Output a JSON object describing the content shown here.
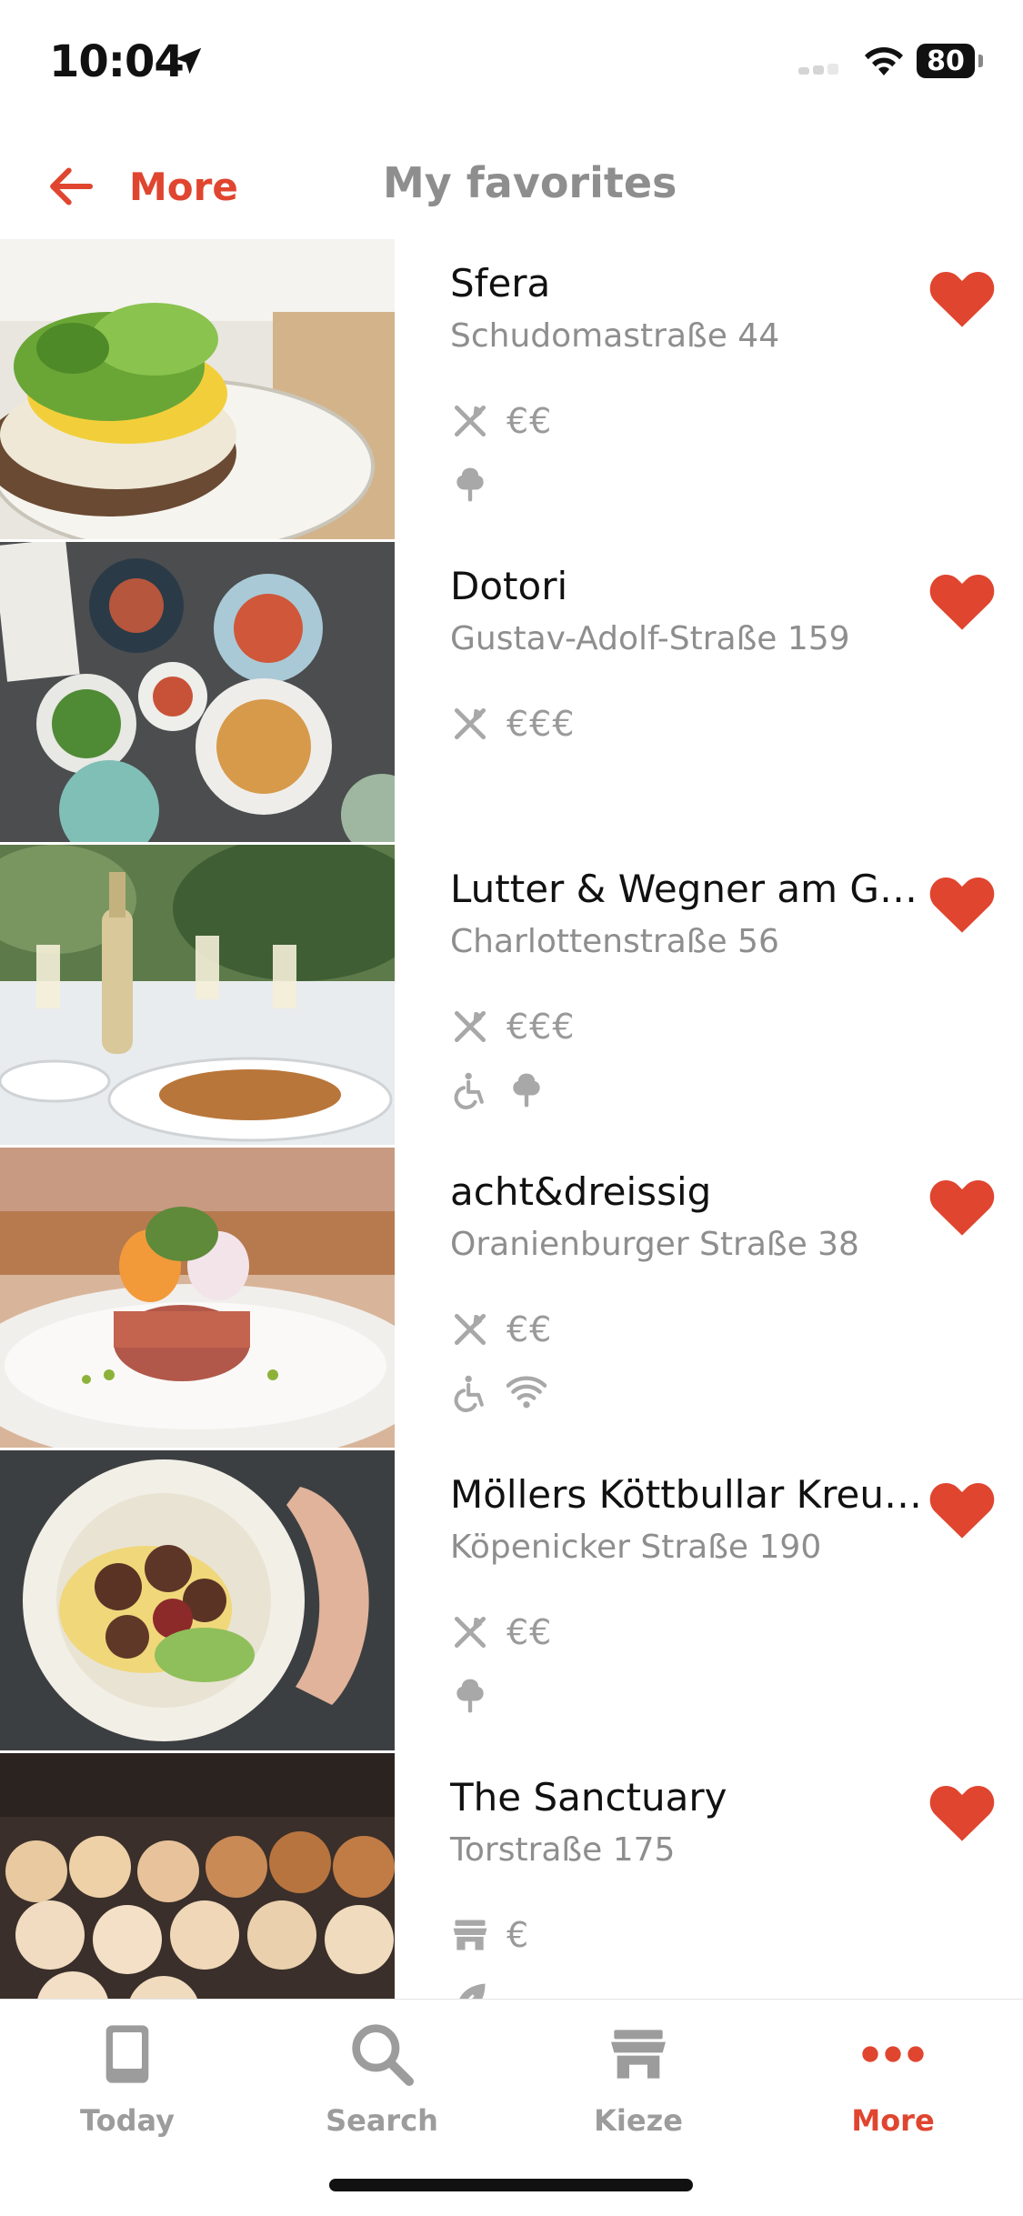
{
  "status_bar": {
    "time": "10:04",
    "battery": "80"
  },
  "nav": {
    "back_label": "More",
    "title": "My favorites"
  },
  "colors": {
    "accent": "#e0452f",
    "muted": "#8e8e8e"
  },
  "favorites": [
    {
      "name": "Sfera",
      "address": "Schudomastraße 44",
      "type_icon": "restaurant-icon",
      "price": "€€",
      "amenities": [
        "tree-icon"
      ],
      "favorited": true
    },
    {
      "name": "Dotori",
      "address": "Gustav-Adolf-Straße 159",
      "type_icon": "restaurant-icon",
      "price": "€€€",
      "amenities": [],
      "favorited": true
    },
    {
      "name": "Lutter & Wegner am Gen...",
      "address": "Charlottenstraße 56",
      "type_icon": "restaurant-icon",
      "price": "€€€",
      "amenities": [
        "wheelchair-icon",
        "tree-icon"
      ],
      "favorited": true
    },
    {
      "name": "acht&dreissig",
      "address": "Oranienburger Straße 38",
      "type_icon": "restaurant-icon",
      "price": "€€",
      "amenities": [
        "wheelchair-icon",
        "wifi-icon"
      ],
      "favorited": true
    },
    {
      "name": "Möllers Köttbullar Kreuz...",
      "address": "Köpenicker Straße 190",
      "type_icon": "restaurant-icon",
      "price": "€€",
      "amenities": [
        "tree-icon"
      ],
      "favorited": true
    },
    {
      "name": "The Sanctuary",
      "address": "Torstraße 175",
      "type_icon": "store-icon",
      "price": "€",
      "amenities": [
        "leaf-icon"
      ],
      "favorited": true
    }
  ],
  "tabs": [
    {
      "label": "Today",
      "icon": "book-icon",
      "active": false
    },
    {
      "label": "Search",
      "icon": "search-icon",
      "active": false
    },
    {
      "label": "Kieze",
      "icon": "store-icon",
      "active": false
    },
    {
      "label": "More",
      "icon": "more-icon",
      "active": true
    }
  ]
}
